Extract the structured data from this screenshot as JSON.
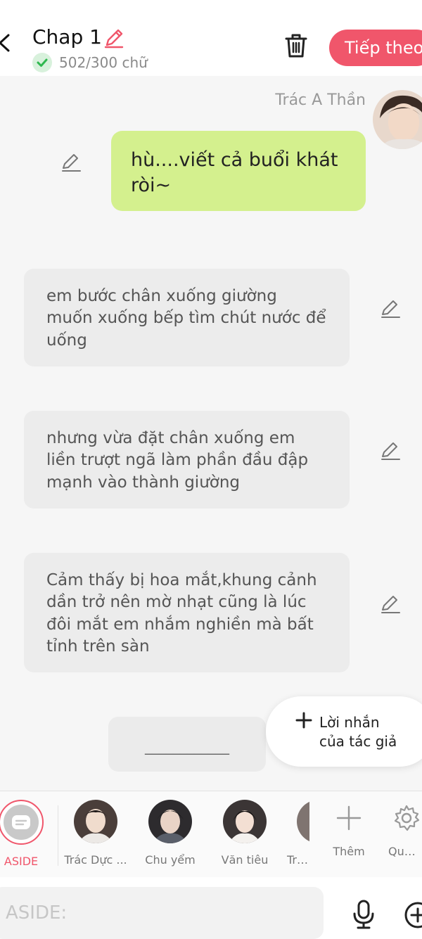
{
  "header": {
    "title": "Chap 1",
    "word_count": "502/300 chữ",
    "next_label": "Tiếp theo"
  },
  "messages": [
    {
      "speaker": "Trác A Thần",
      "text": "hù....viết cả buổi khát ròi~",
      "side": "right",
      "color": "#d4f08e"
    },
    {
      "text": "em bước chân xuống giường muốn xuống bếp tìm chút nước để uống",
      "side": "left"
    },
    {
      "text": "nhưng vừa đặt chân xuống em liền trượt ngã làm phần đầu đập mạnh vào thành giường",
      "side": "left"
    },
    {
      "text": "Cảm thấy bị hoa mắt,khung cảnh dần trở nên mờ nhạt cũng là lúc đôi mắt em nhắm nghiền mà bất tỉnh trên sàn",
      "side": "left"
    }
  ],
  "author_note": {
    "placeholder_line": "____________",
    "button_label": "Lời nhắn\ncủa tác giả"
  },
  "characters": [
    {
      "name": "ASIDE",
      "selected": true
    },
    {
      "name": "Trác Dực ..."
    },
    {
      "name": "Chu yểm"
    },
    {
      "name": "Văn tiêu"
    },
    {
      "name": "Trác"
    }
  ],
  "char_actions": {
    "add_label": "Thêm",
    "manage_label": "Quản l"
  },
  "input": {
    "placeholder": "ASIDE:"
  },
  "colors": {
    "accent": "#f0566b",
    "bubble_green": "#d4f08e",
    "bubble_gray": "#ececec",
    "check_green": "#2fb84f"
  }
}
